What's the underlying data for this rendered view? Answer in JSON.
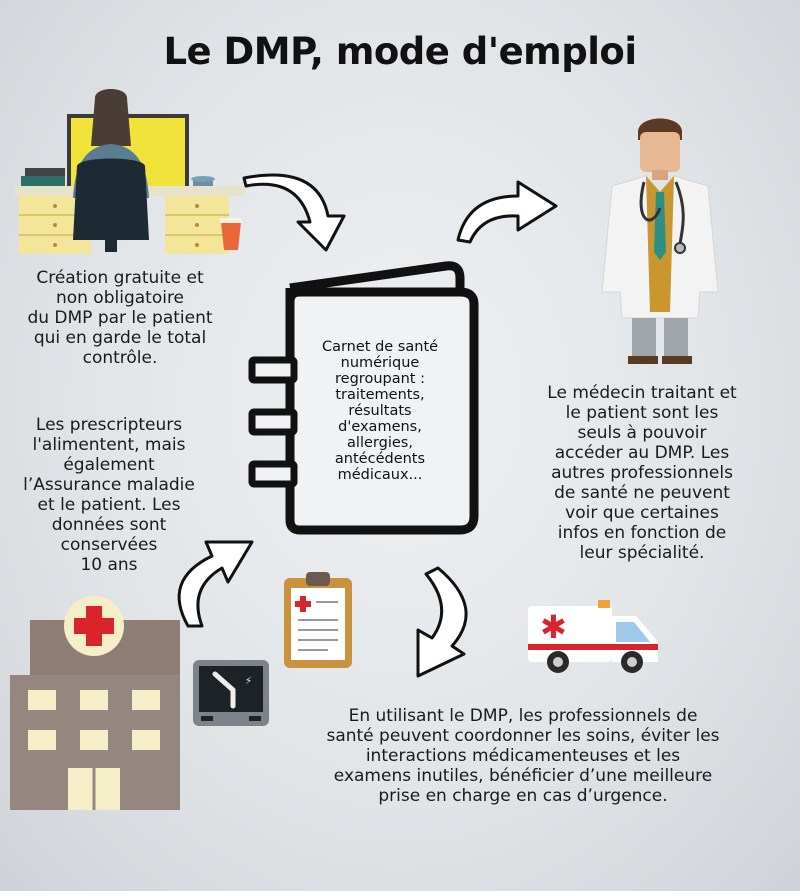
{
  "title": "Le DMP, mode d'emploi",
  "texts": {
    "creation": "Création gratuite et\nnon obligatoire\ndu DMP par le patient\nqui en garde le total\ncontrôle.",
    "prescripteurs": "Les prescripteurs\nl'alimentent, mais\négalement\nl’Assurance maladie\net le patient. Les\ndonnées sont\nconservées\n10 ans",
    "carnet": "Carnet de santé\nnumérique\nregroupant :\ntraitements,\nrésultats\nd'examens,\nallergies,\nantécédents\nmédicaux...",
    "medecin": "Le médecin traitant et\nle patient sont les\nseuls  à pouvoir\naccéder au DMP. Les\nautres professionnels\nde santé ne peuvent\nvoir que certaines\ninfos en fonction de\nleur spécialité.",
    "utilisant": "En utilisant le DMP, les professionnels de\nsanté peuvent coordonner les soins, éviter les\ninteractions médicamenteuses et les\nexamens inutiles, bénéficier d’une meilleure\nprise en charge en cas d’urgence."
  },
  "colors": {
    "background": "#e2e5e8",
    "red_cross": "#d9232d",
    "desk_yellow": "#f3e59a",
    "hospital": "#8d7d75",
    "window_cream": "#f5efc7",
    "clipboard": "#c9933e",
    "ambulance_red": "#d9232d"
  },
  "icons": [
    "woman-at-desk-icon",
    "doctor-icon",
    "notebook-icon",
    "hospital-icon",
    "xray-monitor-icon",
    "clipboard-icon",
    "ambulance-icon",
    "curved-arrow-icon"
  ]
}
